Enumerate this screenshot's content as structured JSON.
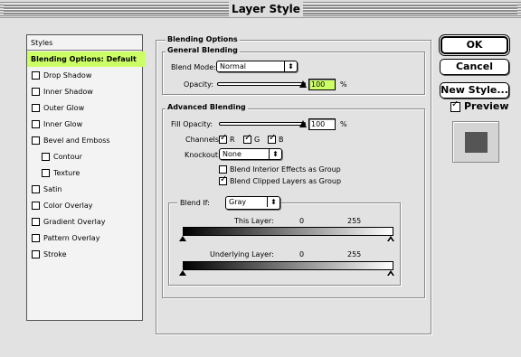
{
  "window": {
    "title": "Layer Style"
  },
  "styles_panel": {
    "header": "Styles",
    "items": [
      {
        "label": "Blending Options: Default",
        "selected": true
      },
      {
        "label": "Drop Shadow"
      },
      {
        "label": "Inner Shadow"
      },
      {
        "label": "Outer Glow"
      },
      {
        "label": "Inner Glow"
      },
      {
        "label": "Bevel and Emboss"
      },
      {
        "label": "Contour",
        "indent": true
      },
      {
        "label": "Texture",
        "indent": true
      },
      {
        "label": "Satin"
      },
      {
        "label": "Color Overlay"
      },
      {
        "label": "Gradient Overlay"
      },
      {
        "label": "Pattern Overlay"
      },
      {
        "label": "Stroke"
      }
    ]
  },
  "blending_options": {
    "title": "Blending Options",
    "general": {
      "title": "General Blending",
      "blend_mode_label": "Blend Mode:",
      "blend_mode_value": "Normal",
      "opacity_label": "Opacity:",
      "opacity_value": "100",
      "opacity_unit": "%"
    },
    "advanced": {
      "title": "Advanced Blending",
      "fill_opacity_label": "Fill Opacity:",
      "fill_opacity_value": "100",
      "fill_opacity_unit": "%",
      "channels_label": "Channels:",
      "channel_r": "R",
      "channel_g": "G",
      "channel_b": "B",
      "knockout_label": "Knockout:",
      "knockout_value": "None",
      "blend_interior": "Blend Interior Effects as Group",
      "blend_clipped": "Blend Clipped Layers as Group",
      "blend_if_label": "Blend If:",
      "blend_if_value": "Gray",
      "this_layer_label": "This Layer:",
      "this_layer_min": "0",
      "this_layer_max": "255",
      "underlying_label": "Underlying Layer:",
      "underlying_min": "0",
      "underlying_max": "255"
    }
  },
  "buttons": {
    "ok": "OK",
    "cancel": "Cancel",
    "new_style": "New Style...",
    "preview": "Preview"
  },
  "colors": {
    "selected_highlight": "#ccff66",
    "preview_swatch": "#555555"
  }
}
